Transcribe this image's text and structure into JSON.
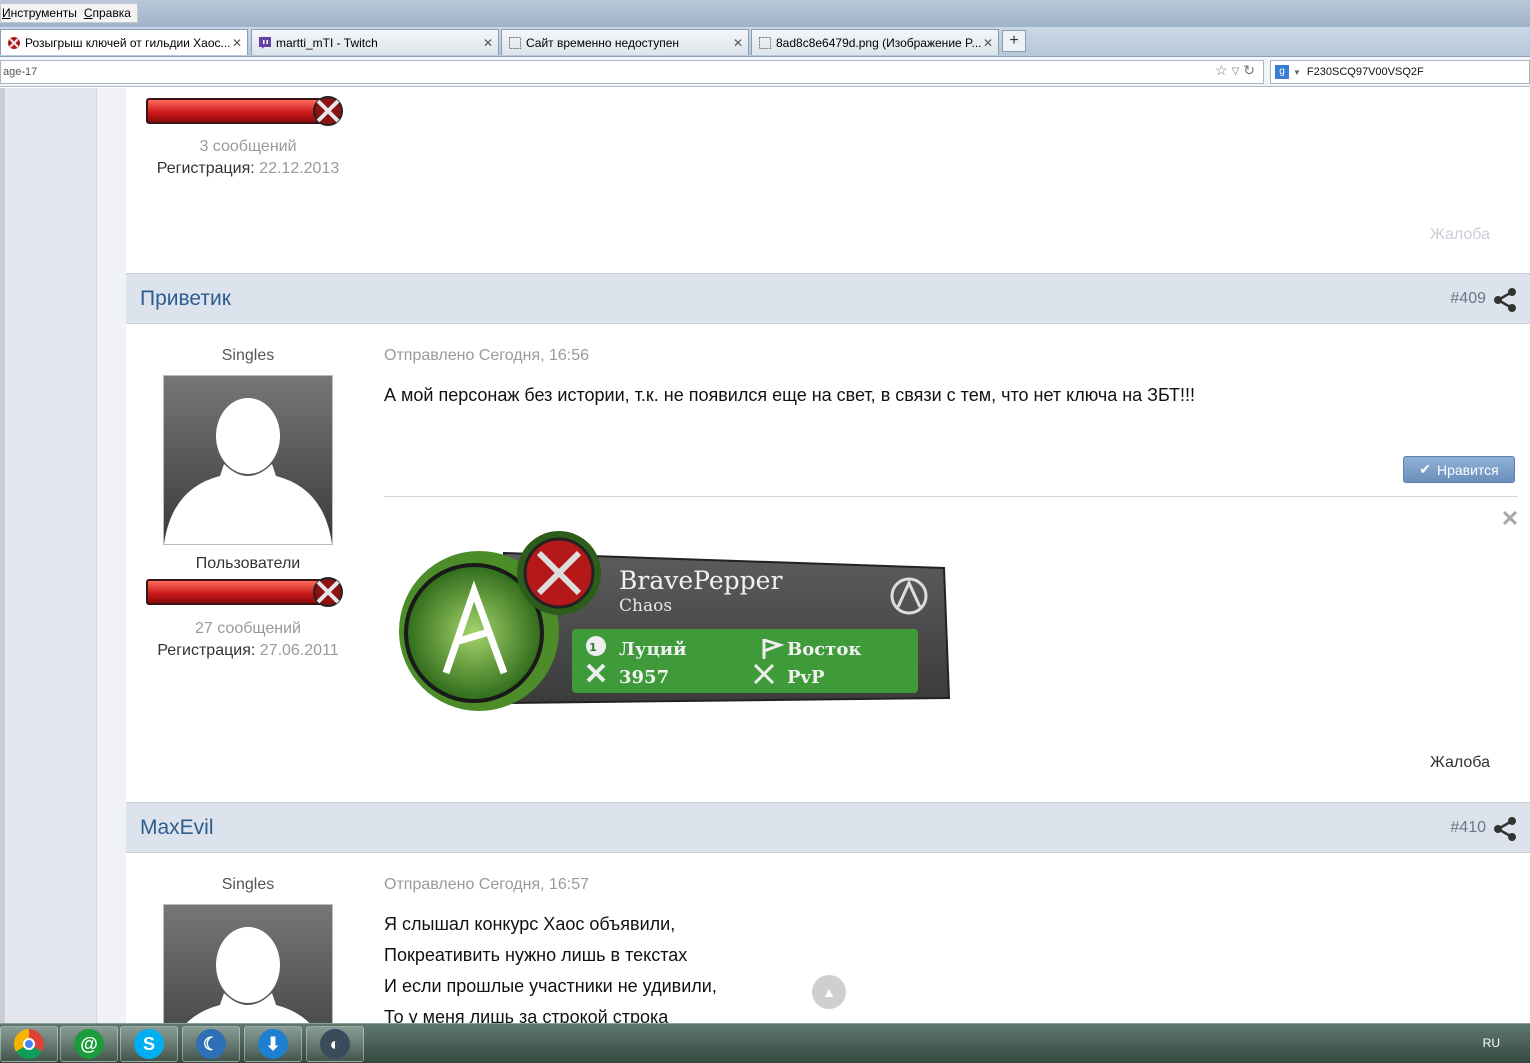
{
  "menu": {
    "tools": "Инструменты",
    "help": "Справка"
  },
  "tabs": [
    {
      "title": "Розыгрыш ключей от гильдии Хаос...",
      "active": true,
      "icon": "archeage-icon"
    },
    {
      "title": "martti_mTI - Twitch",
      "active": false,
      "icon": "twitch-icon"
    },
    {
      "title": "Сайт временно недоступен",
      "active": false,
      "icon": "page-icon"
    },
    {
      "title": "8ad8c8e6479d.png (Изображение P...",
      "active": false,
      "icon": "page-icon"
    }
  ],
  "newtab_label": "+",
  "url": "age-17",
  "search": {
    "value": "F230SCQ97V00VSQ2F",
    "engine": "google-icon"
  },
  "prev_post": {
    "messages": "3 сообщений",
    "reg_label": "Регистрация:",
    "reg_date": "22.12.2013",
    "report": "Жалоба"
  },
  "post409": {
    "author": "Приветик",
    "number": "#409",
    "group": "Singles",
    "role": "Пользователи",
    "messages": "27 сообщений",
    "reg_label": "Регистрация:",
    "reg_date": "27.06.2011",
    "sent": "Отправлено Сегодня, 16:56",
    "text": "А мой персонаж без истории, т.к. не появился еще на свет, в связи с тем, что нет ключа на ЗБТ!!!",
    "like": "Нравится",
    "report": "Жалоба",
    "signature": {
      "name": "BravePepper",
      "guild": "Chaos",
      "level": "1",
      "race": "Луций",
      "faction": "Восток",
      "score": "3957",
      "mode": "PvP"
    }
  },
  "post410": {
    "author": "MaxEvil",
    "number": "#410",
    "group": "Singles",
    "sent": "Отправлено Сегодня, 16:57",
    "lines": [
      "Я слышал конкурс Хаос объявили,",
      "Покреативить нужно лишь в текстах",
      "И если прошлые участники не удивили,",
      "То у меня лишь за строкой строка"
    ]
  },
  "taskbar": {
    "apps": [
      "chrome-icon",
      "mail-agent-icon",
      "skype-icon",
      "app-icon",
      "download-icon",
      "steam-icon"
    ],
    "lang": "RU"
  }
}
